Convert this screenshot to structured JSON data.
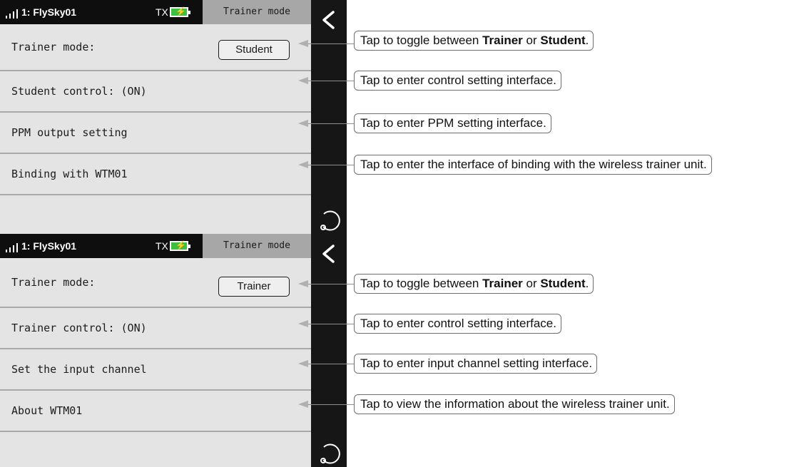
{
  "screens": [
    {
      "status": {
        "model": "1: FlySky01",
        "tx": "TX",
        "mode_tab": "Trainer mode"
      },
      "rows": [
        {
          "label": "Trainer mode:",
          "button": "Student"
        },
        {
          "label": "Student control: (ON)"
        },
        {
          "label": "PPM output setting"
        },
        {
          "label": "Binding with WTM01"
        }
      ],
      "callouts": [
        {
          "pre": "Tap to toggle between ",
          "b1": "Trainer",
          "mid": " or ",
          "b2": "Student",
          "post": "."
        },
        {
          "text": "Tap to enter control setting interface."
        },
        {
          "text": "Tap to enter PPM setting interface."
        },
        {
          "text": "Tap to enter the interface of binding with the wireless trainer unit."
        }
      ]
    },
    {
      "status": {
        "model": "1: FlySky01",
        "tx": "TX",
        "mode_tab": "Trainer mode"
      },
      "rows": [
        {
          "label": "Trainer mode:",
          "button": "Trainer"
        },
        {
          "label": "Trainer control: (ON)"
        },
        {
          "label": "Set the input channel"
        },
        {
          "label": "About WTM01"
        }
      ],
      "callouts": [
        {
          "pre": "Tap to toggle between ",
          "b1": "Trainer",
          "mid": " or ",
          "b2": "Student",
          "post": "."
        },
        {
          "text": "Tap to enter control setting interface."
        },
        {
          "text": "Tap to enter input channel setting interface."
        },
        {
          "text": "Tap to view the information about  the wireless trainer unit."
        }
      ]
    }
  ],
  "icons": {
    "signal": "signal-bars-icon",
    "battery": "battery-charging-icon",
    "back": "chevron-left-icon",
    "refresh": "refresh-icon",
    "pointer": "pointer-arrow-icon"
  },
  "colors": {
    "status_bar": "#0e0e0e",
    "mode_tab": "#a7a7a7",
    "screen_bg": "#e4e4e4",
    "sidebar": "#161616",
    "battery": "#3fbf3f"
  }
}
